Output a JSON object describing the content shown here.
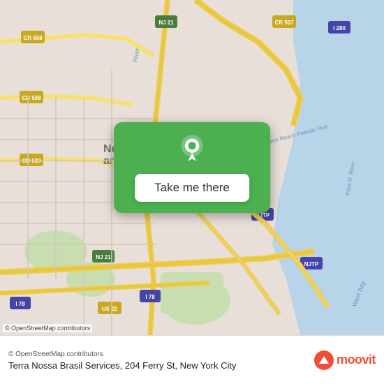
{
  "map": {
    "alt": "Map of Newark area, New York",
    "attribution": "© OpenStreetMap contributors"
  },
  "overlay": {
    "pin_label": "Location pin",
    "cta_button_label": "Take me there"
  },
  "info_bar": {
    "address": "Terra Nossa Brasil Services, 204 Ferry St, New York City",
    "moovit_alt": "Moovit",
    "moovit_word": "moovit"
  }
}
